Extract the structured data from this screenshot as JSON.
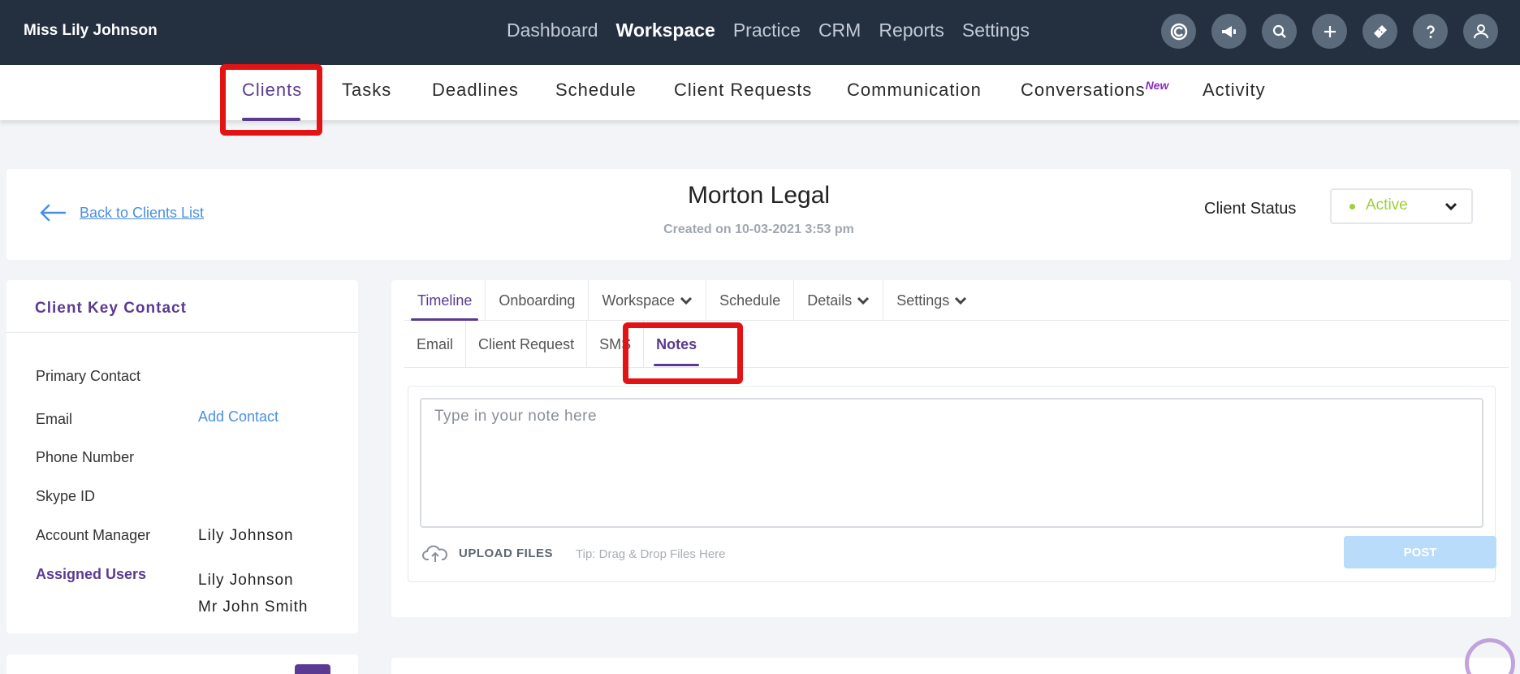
{
  "topbar": {
    "user_name": "Miss Lily Johnson",
    "nav": [
      "Dashboard",
      "Workspace",
      "Practice",
      "CRM",
      "Reports",
      "Settings"
    ],
    "active_nav": "Workspace",
    "icons": [
      "logo-c-icon",
      "megaphone-icon",
      "search-icon",
      "plus-icon",
      "ticket-icon",
      "help-icon",
      "user-icon"
    ]
  },
  "subnav": {
    "items": [
      "Clients",
      "Tasks",
      "Deadlines",
      "Schedule",
      "Client Requests",
      "Communication",
      "Conversations",
      "Activity"
    ],
    "new_badge": "New",
    "active": "Clients"
  },
  "header": {
    "back_label": "Back to Clients List",
    "client_name": "Morton Legal",
    "created": "Created on 10-03-2021 3:53 pm",
    "status_label": "Client Status",
    "status_value": "Active"
  },
  "key_contact": {
    "title": "Client Key Contact",
    "primary_contact": "Primary Contact",
    "email": "Email",
    "add_contact": "Add Contact",
    "phone": "Phone Number",
    "skype": "Skype ID",
    "account_manager_label": "Account Manager",
    "account_manager_value": "Lily Johnson",
    "assigned_users_label": "Assigned Users",
    "assigned_users": [
      "Lily Johnson",
      "Mr John Smith"
    ]
  },
  "timeline": {
    "tabs": [
      "Timeline",
      "Onboarding",
      "Workspace",
      "Schedule",
      "Details",
      "Settings"
    ],
    "active_tab": "Timeline",
    "sub_tabs": [
      "Email",
      "Client Request",
      "SMS",
      "Notes"
    ],
    "active_sub_tab": "Notes",
    "note_placeholder": "Type in your note here",
    "upload_label": "UPLOAD FILES",
    "tip": "Tip: Drag & Drop Files Here",
    "post_label": "POST"
  },
  "colors": {
    "topbar": "#243040",
    "accent": "#5b3a91",
    "link": "#4a90e2",
    "active_status": "#9bd13a",
    "highlight": "#e31313"
  }
}
